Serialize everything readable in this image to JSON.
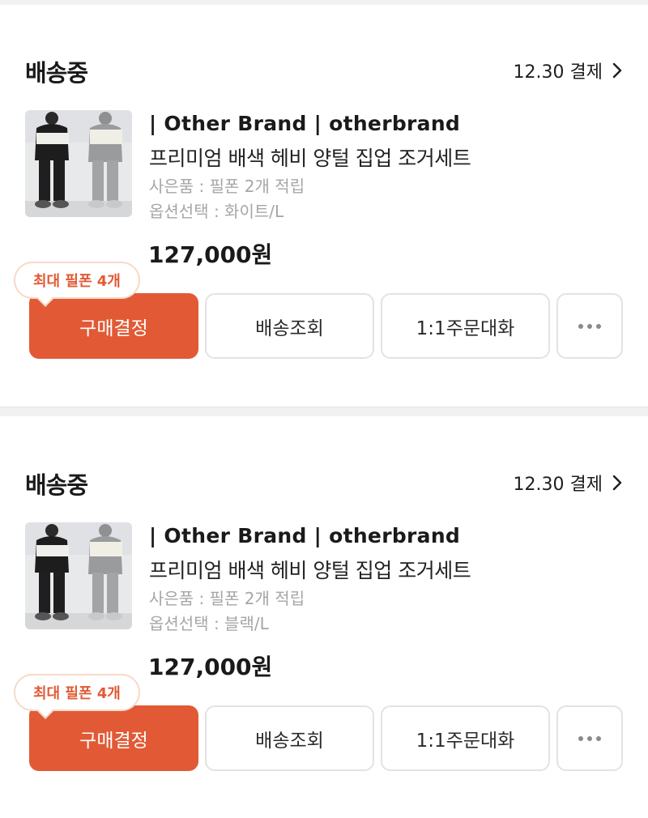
{
  "orders": [
    {
      "status": "배송중",
      "paid_date": "12.30 결제",
      "brand": "| Other Brand | otherbrand",
      "product_name": "프리미엄 배색 헤비 양털 집업 조거세트",
      "gift": "사은품 : 필폰 2개 적립",
      "option": "옵션선택 : 화이트/L",
      "price": "127,000원",
      "coupon_badge": "최대 필폰 4개",
      "buttons": {
        "purchase_confirm": "구매결정",
        "track_delivery": "배송조회",
        "chat": "1:1주문대화"
      }
    },
    {
      "status": "배송중",
      "paid_date": "12.30 결제",
      "brand": "| Other Brand | otherbrand",
      "product_name": "프리미엄 배색 헤비 양털 집업 조거세트",
      "gift": "사은품 : 필폰 2개 적립",
      "option": "옵션선택 : 블랙/L",
      "price": "127,000원",
      "coupon_badge": "최대 필폰 4개",
      "buttons": {
        "purchase_confirm": "구매결정",
        "track_delivery": "배송조회",
        "chat": "1:1주문대화"
      }
    }
  ],
  "icons": {
    "chevron": "chevron-right-icon",
    "more": "more-horizontal-icon"
  },
  "colors": {
    "accent": "#e15a35",
    "muted_text": "#a6a6a6",
    "divider": "#f1f1f1",
    "button_border": "#e3e3e3"
  }
}
